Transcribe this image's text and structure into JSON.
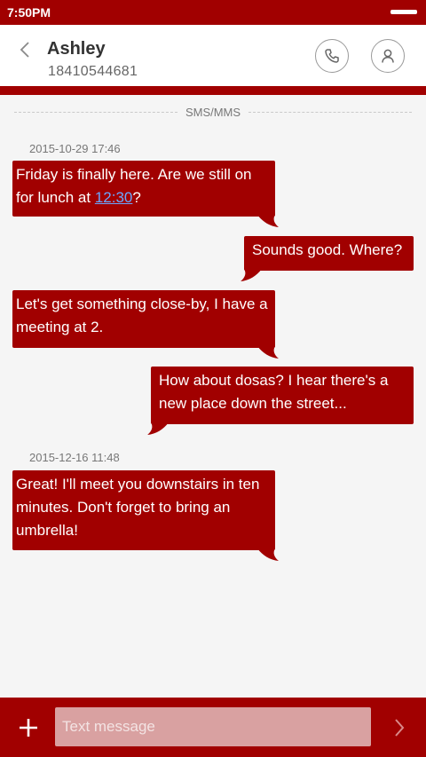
{
  "status_bar": {
    "time": "7:50PM"
  },
  "header": {
    "contact_name": "Ashley",
    "contact_number": "18410544681",
    "icons": {
      "back": "chevron-left-icon",
      "call": "phone-icon",
      "profile": "person-icon"
    }
  },
  "thread": {
    "channel_label": "SMS/MMS",
    "groups": [
      {
        "timestamp": "2015-10-29 17:46",
        "messages": [
          {
            "direction": "incoming",
            "text_before": "Friday is finally here. Are we still on for lunch at ",
            "link": "12:30",
            "text_after": "?"
          },
          {
            "direction": "outgoing",
            "text": "Sounds good. Where?"
          },
          {
            "direction": "incoming",
            "text": "Let's get something close-by, I have a meeting at 2."
          },
          {
            "direction": "outgoing",
            "text": "How about dosas? I hear there's a new place down the street..."
          }
        ]
      },
      {
        "timestamp": "2015-12-16 11:48",
        "messages": [
          {
            "direction": "incoming",
            "text": "Great! I'll meet you downstairs in ten minutes. Don't forget to bring an umbrella!"
          }
        ]
      }
    ]
  },
  "composer": {
    "placeholder": "Text message",
    "value": "",
    "icons": {
      "add": "plus-icon",
      "send": "send-chevron-icon"
    }
  },
  "colors": {
    "accent": "#a10000",
    "bubble": "#a10000",
    "link": "#6aa7ff",
    "input_bg": "#d9a1a1"
  }
}
